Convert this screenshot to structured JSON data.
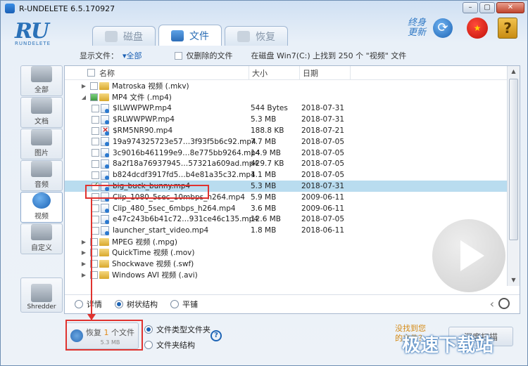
{
  "window": {
    "title": "R-UNDELETE 6.5.170927"
  },
  "logo": {
    "mark": "RU",
    "subtitle": "RUNDELETE"
  },
  "tabs": [
    {
      "label": "磁盘",
      "icon": "disk-icon"
    },
    {
      "label": "文件",
      "icon": "files-icon"
    },
    {
      "label": "恢复",
      "icon": "recover-icon"
    }
  ],
  "topright": {
    "update_text": "终身更新",
    "flag_glyph": "★",
    "help_glyph": "?"
  },
  "filterbar": {
    "show_label": "显示文件：",
    "show_value": "▾全部",
    "deleted_only_label": "仅删除的文件",
    "summary": "在磁盘 Win7(C:) 上找到 250 个 \"视频\" 文件"
  },
  "sidebar": [
    {
      "label": "全部"
    },
    {
      "label": "文档"
    },
    {
      "label": "图片"
    },
    {
      "label": "音频"
    },
    {
      "label": "视频"
    },
    {
      "label": "自定义"
    }
  ],
  "shredder": {
    "label": "Shredder"
  },
  "columns": {
    "name": "名称",
    "size": "大小",
    "date": "日期"
  },
  "rows": [
    {
      "type": "folder",
      "exp": "▶",
      "name": "Matroska 视频 (.mkv)",
      "size": "",
      "date": ""
    },
    {
      "type": "folder",
      "exp": "◢",
      "name": "MP4 文件 (.mp4)",
      "size": "",
      "date": "",
      "partial": true
    },
    {
      "type": "file",
      "name": "$ILWWPWP.mp4",
      "size": "544 Bytes",
      "date": "2018-07-31"
    },
    {
      "type": "file",
      "name": "$RLWWPWP.mp4",
      "size": "5.3 MB",
      "date": "2018-07-31"
    },
    {
      "type": "file",
      "bad": true,
      "name": "$RM5NR90.mp4",
      "size": "188.8 KB",
      "date": "2018-07-21"
    },
    {
      "type": "file",
      "name": "19a974325723e57…3f93f5b6c92.mp4",
      "size": "7.7 MB",
      "date": "2018-07-05"
    },
    {
      "type": "file",
      "name": "3c9016b461199e9…8e775bb9264.mp4",
      "size": "14.9 MB",
      "date": "2018-07-05"
    },
    {
      "type": "file",
      "name": "8a2f18a76937945…57321a609ad.mp4",
      "size": "429.7 KB",
      "date": "2018-07-05"
    },
    {
      "type": "file",
      "name": "b824dcdf3917fd5…b4e81a35c32.mp4",
      "size": "1.1 MB",
      "date": "2018-07-05"
    },
    {
      "type": "file",
      "selected": true,
      "name": "big_buck_bunny.mp4",
      "size": "5.3 MB",
      "date": "2018-07-31"
    },
    {
      "type": "file",
      "name": "Clip_1080_5sec_10mbps_h264.mp4",
      "size": "5.9 MB",
      "date": "2009-06-11"
    },
    {
      "type": "file",
      "name": "Clip_480_5sec_6mbps_h264.mp4",
      "size": "3.6 MB",
      "date": "2009-06-11"
    },
    {
      "type": "file",
      "name": "e47c243b6b41c72…931ce46c135.mp4",
      "size": "12.6 MB",
      "date": "2018-07-05"
    },
    {
      "type": "file",
      "name": "launcher_start_video.mp4",
      "size": "1.8 MB",
      "date": "2018-06-11"
    },
    {
      "type": "folder",
      "exp": "▶",
      "name": "MPEG 视频 (.mpg)",
      "size": "",
      "date": ""
    },
    {
      "type": "folder",
      "exp": "▶",
      "name": "QuickTime 视频 (.mov)",
      "size": "",
      "date": ""
    },
    {
      "type": "folder",
      "exp": "▶",
      "name": "Shockwave 视频 (.swf)",
      "size": "",
      "date": ""
    },
    {
      "type": "folder",
      "exp": "▶",
      "name": "Windows AVI 视频 (.avi)",
      "size": "",
      "date": ""
    }
  ],
  "viewbar": {
    "details": "详情",
    "tree": "树状结构",
    "flat": "平铺"
  },
  "recover": {
    "prefix": "恢复",
    "count": "1",
    "suffix": "个文件",
    "size": "5.3 MB"
  },
  "modes": {
    "by_type": "文件类型文件夹",
    "by_folder": "文件夹结构"
  },
  "notfound": {
    "line1": "没找到您",
    "line2": "的文件？"
  },
  "deepscan": {
    "label": "深度扫描"
  },
  "watermark": "极速下载站",
  "colors": {
    "accent": "#1d64b5",
    "annotation": "#e0332f",
    "selection": "#b9dcef"
  }
}
